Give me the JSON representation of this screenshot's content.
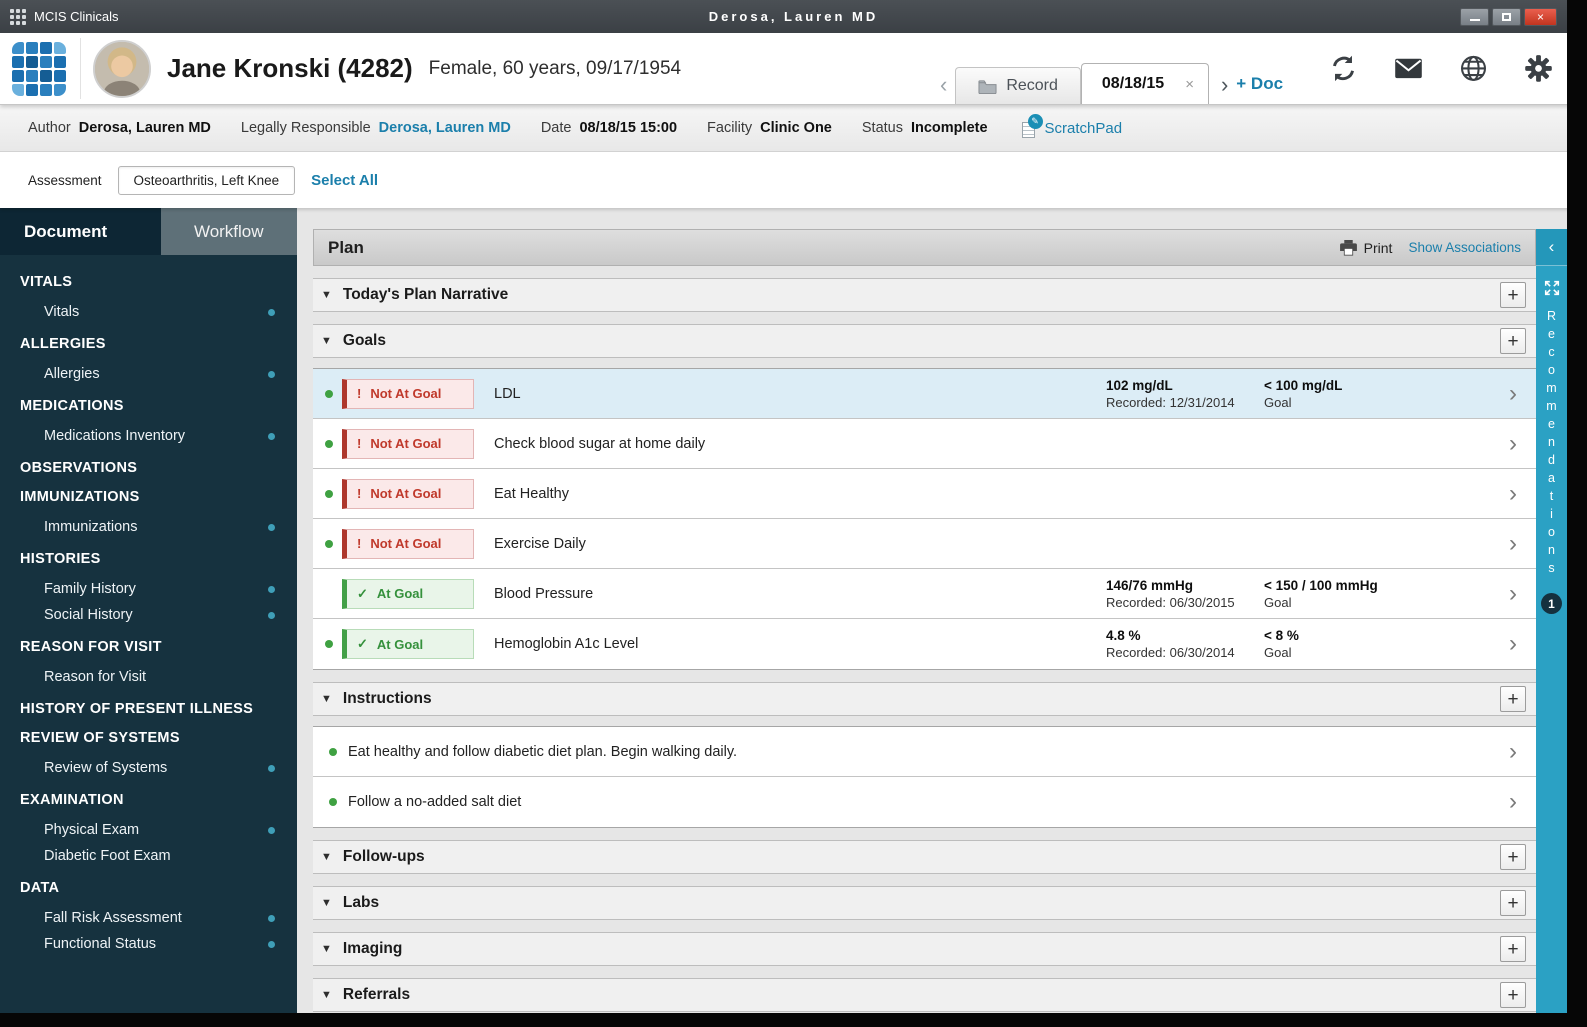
{
  "titlebar": {
    "app_name": "MCIS Clinicals",
    "title": "Derosa, Lauren MD"
  },
  "header": {
    "patient_name": "Jane Kronski (4282)",
    "patient_info": "Female, 60 years,  09/17/1954",
    "record_tab": "Record",
    "date_tab": "08/18/15",
    "add_doc": "+ Doc"
  },
  "meta": {
    "author_label": "Author",
    "author": "Derosa, Lauren MD",
    "legally_responsible_label": "Legally Responsible",
    "legally_responsible": "Derosa, Lauren MD",
    "date_label": "Date",
    "date": "08/18/15 15:00",
    "facility_label": "Facility",
    "facility": "Clinic One",
    "status_label": "Status",
    "status": "Incomplete",
    "scratchpad": "ScratchPad"
  },
  "assessment": {
    "label": "Assessment",
    "value": "Osteoarthritis, Left Knee",
    "select_all": "Select All"
  },
  "sidebar": {
    "tabs": [
      {
        "label": "Document"
      },
      {
        "label": "Workflow"
      }
    ],
    "sections": [
      {
        "header": "VITALS",
        "items": [
          {
            "label": "Vitals",
            "dot": true
          }
        ]
      },
      {
        "header": "ALLERGIES",
        "items": [
          {
            "label": "Allergies",
            "dot": true
          }
        ]
      },
      {
        "header": "MEDICATIONS",
        "items": [
          {
            "label": "Medications Inventory",
            "dot": true
          }
        ]
      },
      {
        "header": "OBSERVATIONS",
        "items": []
      },
      {
        "header": "IMMUNIZATIONS",
        "items": [
          {
            "label": "Immunizations",
            "dot": true
          }
        ]
      },
      {
        "header": "HISTORIES",
        "items": [
          {
            "label": "Family History",
            "dot": true
          },
          {
            "label": "Social History",
            "dot": true
          }
        ]
      },
      {
        "header": "REASON FOR VISIT",
        "items": [
          {
            "label": "Reason for Visit",
            "dot": false
          }
        ]
      },
      {
        "header": "HISTORY OF PRESENT ILLNESS",
        "items": []
      },
      {
        "header": "REVIEW OF SYSTEMS",
        "items": [
          {
            "label": "Review of Systems",
            "dot": true
          }
        ]
      },
      {
        "header": "EXAMINATION",
        "items": [
          {
            "label": "Physical Exam",
            "dot": true
          },
          {
            "label": "Diabetic Foot Exam",
            "dot": false
          }
        ]
      },
      {
        "header": "DATA",
        "items": [
          {
            "label": "Fall Risk Assessment",
            "dot": true
          },
          {
            "label": "Functional Status",
            "dot": true
          }
        ]
      }
    ]
  },
  "plan": {
    "title": "Plan",
    "print_label": "Print",
    "show_associations": "Show Associations",
    "add_label": "+",
    "sections": {
      "narrative": "Today's Plan Narrative",
      "goals": "Goals",
      "instructions": "Instructions",
      "followups": "Follow-ups",
      "labs": "Labs",
      "imaging": "Imaging",
      "referrals": "Referrals"
    },
    "goals": [
      {
        "status": "not_at_goal",
        "badge": "Not At Goal",
        "label": "LDL",
        "value": "102 mg/dL",
        "recorded": "Recorded: 12/31/2014",
        "goal_value": "< 100 mg/dL",
        "goal_label": "Goal"
      },
      {
        "status": "not_at_goal",
        "badge": "Not At Goal",
        "label": "Check blood sugar at home daily"
      },
      {
        "status": "not_at_goal",
        "badge": "Not At Goal",
        "label": "Eat Healthy"
      },
      {
        "status": "not_at_goal",
        "badge": "Not At Goal",
        "label": "Exercise Daily"
      },
      {
        "status": "at_goal",
        "badge": "At Goal",
        "label": "Blood Pressure",
        "value": "146/76 mmHg",
        "recorded": "Recorded: 06/30/2015",
        "goal_value": "< 150 / 100 mmHg",
        "goal_label": "Goal"
      },
      {
        "status": "at_goal",
        "badge": "At Goal",
        "label": "Hemoglobin A1c Level",
        "value": "4.8 %",
        "recorded": "Recorded: 06/30/2014",
        "goal_value": "< 8 %",
        "goal_label": "Goal"
      }
    ],
    "instructions": [
      {
        "label": "Eat healthy and follow diabetic diet plan.  Begin walking daily."
      },
      {
        "label": "Follow a no-added salt diet"
      }
    ]
  },
  "rail": {
    "label": "Recommendations",
    "count": "1"
  },
  "icons": {
    "collapse_triangle": "▼",
    "chevron_right": "›",
    "chevron_left": "‹",
    "close": "×",
    "check": "✓",
    "exclamation": "!",
    "pencil": "✎"
  },
  "colors": {
    "accent_teal": "#1b7fab",
    "sidebar_navy": "#16323f",
    "rail_teal": "#2ba1c4",
    "not_at_goal_red": "#c0392b",
    "at_goal_green": "#35913c"
  }
}
